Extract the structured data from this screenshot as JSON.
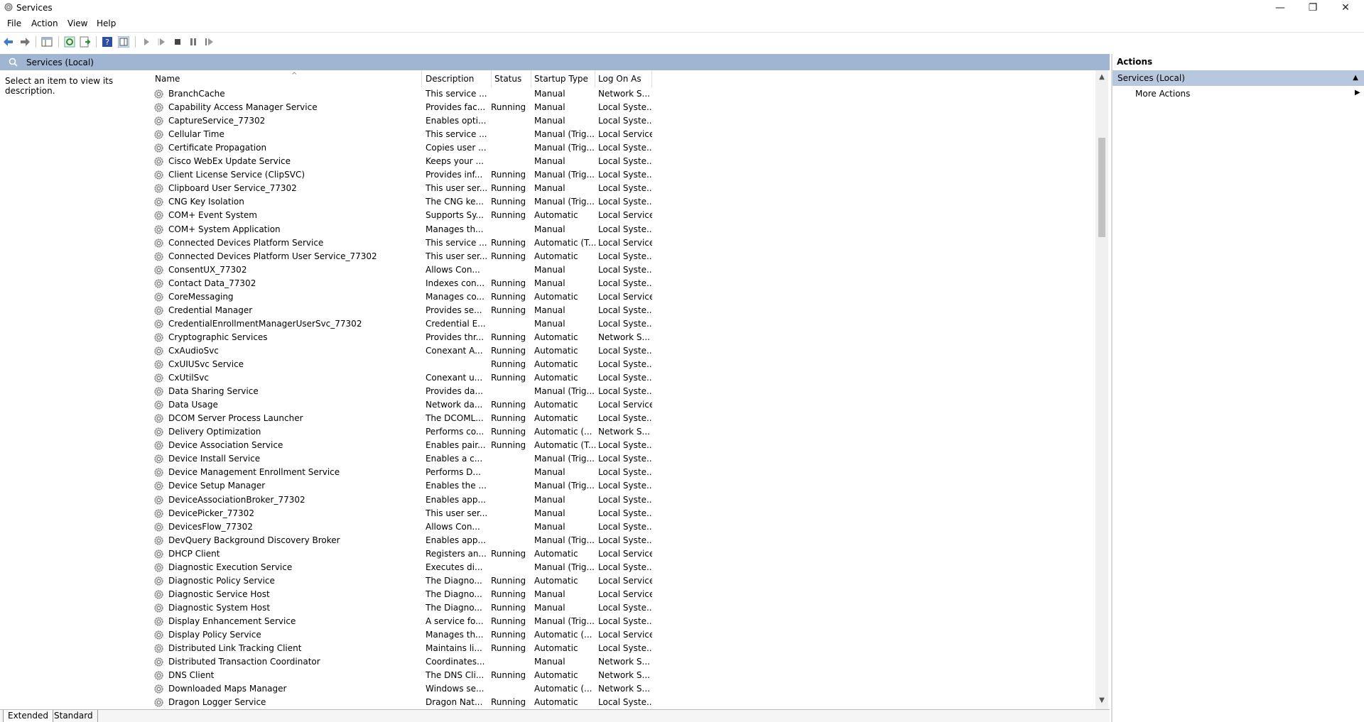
{
  "window": {
    "title": "Services",
    "minimize": "—",
    "maximize": "❐",
    "close": "✕"
  },
  "menu": [
    "File",
    "Action",
    "View",
    "Help"
  ],
  "toolbar": [
    "back-icon",
    "forward-icon",
    "show-hide-console-tree-icon",
    "refresh-icon",
    "export-list-icon",
    "help-icon",
    "show-action-pane-icon",
    "start-service-icon",
    "start-service-alt-icon",
    "stop-service-icon",
    "pause-service-icon",
    "restart-service-icon"
  ],
  "scope": {
    "title": "Services (Local)"
  },
  "description_prompt": "Select an item to view its description.",
  "columns": {
    "name": "Name",
    "description": "Description",
    "status": "Status",
    "startup": "Startup Type",
    "logon": "Log On As"
  },
  "services": [
    {
      "name": "BranchCache",
      "description": "This service ...",
      "status": "",
      "startup": "Manual",
      "logon": "Network S..."
    },
    {
      "name": "Capability Access Manager Service",
      "description": "Provides fac...",
      "status": "Running",
      "startup": "Manual",
      "logon": "Local Syste..."
    },
    {
      "name": "CaptureService_77302",
      "description": "Enables opti...",
      "status": "",
      "startup": "Manual",
      "logon": "Local Syste..."
    },
    {
      "name": "Cellular Time",
      "description": "This service ...",
      "status": "",
      "startup": "Manual (Trig...",
      "logon": "Local Service"
    },
    {
      "name": "Certificate Propagation",
      "description": "Copies user ...",
      "status": "",
      "startup": "Manual (Trig...",
      "logon": "Local Syste..."
    },
    {
      "name": "Cisco WebEx Update Service",
      "description": "Keeps your ...",
      "status": "",
      "startup": "Manual",
      "logon": "Local Syste..."
    },
    {
      "name": "Client License Service (ClipSVC)",
      "description": "Provides inf...",
      "status": "Running",
      "startup": "Manual (Trig...",
      "logon": "Local Syste..."
    },
    {
      "name": "Clipboard User Service_77302",
      "description": "This user ser...",
      "status": "Running",
      "startup": "Manual",
      "logon": "Local Syste..."
    },
    {
      "name": "CNG Key Isolation",
      "description": "The CNG ke...",
      "status": "Running",
      "startup": "Manual (Trig...",
      "logon": "Local Syste..."
    },
    {
      "name": "COM+ Event System",
      "description": "Supports Sy...",
      "status": "Running",
      "startup": "Automatic",
      "logon": "Local Service"
    },
    {
      "name": "COM+ System Application",
      "description": "Manages th...",
      "status": "",
      "startup": "Manual",
      "logon": "Local Syste..."
    },
    {
      "name": "Connected Devices Platform Service",
      "description": "This service ...",
      "status": "Running",
      "startup": "Automatic (T...",
      "logon": "Local Service"
    },
    {
      "name": "Connected Devices Platform User Service_77302",
      "description": "This user ser...",
      "status": "Running",
      "startup": "Automatic",
      "logon": "Local Syste..."
    },
    {
      "name": "ConsentUX_77302",
      "description": "Allows Con...",
      "status": "",
      "startup": "Manual",
      "logon": "Local Syste..."
    },
    {
      "name": "Contact Data_77302",
      "description": "Indexes con...",
      "status": "Running",
      "startup": "Manual",
      "logon": "Local Syste..."
    },
    {
      "name": "CoreMessaging",
      "description": "Manages co...",
      "status": "Running",
      "startup": "Automatic",
      "logon": "Local Service"
    },
    {
      "name": "Credential Manager",
      "description": "Provides se...",
      "status": "Running",
      "startup": "Manual",
      "logon": "Local Syste..."
    },
    {
      "name": "CredentialEnrollmentManagerUserSvc_77302",
      "description": "Credential E...",
      "status": "",
      "startup": "Manual",
      "logon": "Local Syste..."
    },
    {
      "name": "Cryptographic Services",
      "description": "Provides thr...",
      "status": "Running",
      "startup": "Automatic",
      "logon": "Network S..."
    },
    {
      "name": "CxAudioSvc",
      "description": "Conexant A...",
      "status": "Running",
      "startup": "Automatic",
      "logon": "Local Syste..."
    },
    {
      "name": "CxUIUSvc Service",
      "description": "",
      "status": "Running",
      "startup": "Automatic",
      "logon": "Local Syste..."
    },
    {
      "name": "CxUtilSvc",
      "description": "Conexant u...",
      "status": "Running",
      "startup": "Automatic",
      "logon": "Local Syste..."
    },
    {
      "name": "Data Sharing Service",
      "description": "Provides da...",
      "status": "",
      "startup": "Manual (Trig...",
      "logon": "Local Syste..."
    },
    {
      "name": "Data Usage",
      "description": "Network da...",
      "status": "Running",
      "startup": "Automatic",
      "logon": "Local Service"
    },
    {
      "name": "DCOM Server Process Launcher",
      "description": "The DCOML...",
      "status": "Running",
      "startup": "Automatic",
      "logon": "Local Syste..."
    },
    {
      "name": "Delivery Optimization",
      "description": "Performs co...",
      "status": "Running",
      "startup": "Automatic (...",
      "logon": "Network S..."
    },
    {
      "name": "Device Association Service",
      "description": "Enables pair...",
      "status": "Running",
      "startup": "Automatic (T...",
      "logon": "Local Syste..."
    },
    {
      "name": "Device Install Service",
      "description": "Enables a c...",
      "status": "",
      "startup": "Manual (Trig...",
      "logon": "Local Syste..."
    },
    {
      "name": "Device Management Enrollment Service",
      "description": "Performs D...",
      "status": "",
      "startup": "Manual",
      "logon": "Local Syste..."
    },
    {
      "name": "Device Setup Manager",
      "description": "Enables the ...",
      "status": "",
      "startup": "Manual (Trig...",
      "logon": "Local Syste..."
    },
    {
      "name": "DeviceAssociationBroker_77302",
      "description": "Enables app...",
      "status": "",
      "startup": "Manual",
      "logon": "Local Syste..."
    },
    {
      "name": "DevicePicker_77302",
      "description": "This user ser...",
      "status": "",
      "startup": "Manual",
      "logon": "Local Syste..."
    },
    {
      "name": "DevicesFlow_77302",
      "description": "Allows Con...",
      "status": "",
      "startup": "Manual",
      "logon": "Local Syste..."
    },
    {
      "name": "DevQuery Background Discovery Broker",
      "description": "Enables app...",
      "status": "",
      "startup": "Manual (Trig...",
      "logon": "Local Syste..."
    },
    {
      "name": "DHCP Client",
      "description": "Registers an...",
      "status": "Running",
      "startup": "Automatic",
      "logon": "Local Service"
    },
    {
      "name": "Diagnostic Execution Service",
      "description": "Executes di...",
      "status": "",
      "startup": "Manual (Trig...",
      "logon": "Local Syste..."
    },
    {
      "name": "Diagnostic Policy Service",
      "description": "The Diagno...",
      "status": "Running",
      "startup": "Automatic",
      "logon": "Local Service"
    },
    {
      "name": "Diagnostic Service Host",
      "description": "The Diagno...",
      "status": "Running",
      "startup": "Manual",
      "logon": "Local Service"
    },
    {
      "name": "Diagnostic System Host",
      "description": "The Diagno...",
      "status": "Running",
      "startup": "Manual",
      "logon": "Local Syste..."
    },
    {
      "name": "Display Enhancement Service",
      "description": "A service fo...",
      "status": "Running",
      "startup": "Manual (Trig...",
      "logon": "Local Syste..."
    },
    {
      "name": "Display Policy Service",
      "description": "Manages th...",
      "status": "Running",
      "startup": "Automatic (...",
      "logon": "Local Service"
    },
    {
      "name": "Distributed Link Tracking Client",
      "description": "Maintains li...",
      "status": "Running",
      "startup": "Automatic",
      "logon": "Local Syste..."
    },
    {
      "name": "Distributed Transaction Coordinator",
      "description": "Coordinates...",
      "status": "",
      "startup": "Manual",
      "logon": "Network S..."
    },
    {
      "name": "DNS Client",
      "description": "The DNS Cli...",
      "status": "Running",
      "startup": "Automatic",
      "logon": "Network S..."
    },
    {
      "name": "Downloaded Maps Manager",
      "description": "Windows se...",
      "status": "",
      "startup": "Automatic (...",
      "logon": "Network S..."
    },
    {
      "name": "Dragon Logger Service",
      "description": "Dragon Nat...",
      "status": "Running",
      "startup": "Automatic",
      "logon": "Local Syste..."
    }
  ],
  "tabs": [
    "Extended",
    "Standard"
  ],
  "actions": {
    "header": "Actions",
    "group": "Services (Local)",
    "more": "More Actions"
  },
  "colors": {
    "header_band": "#9fb5d2",
    "action_group": "#b7c7dd"
  }
}
